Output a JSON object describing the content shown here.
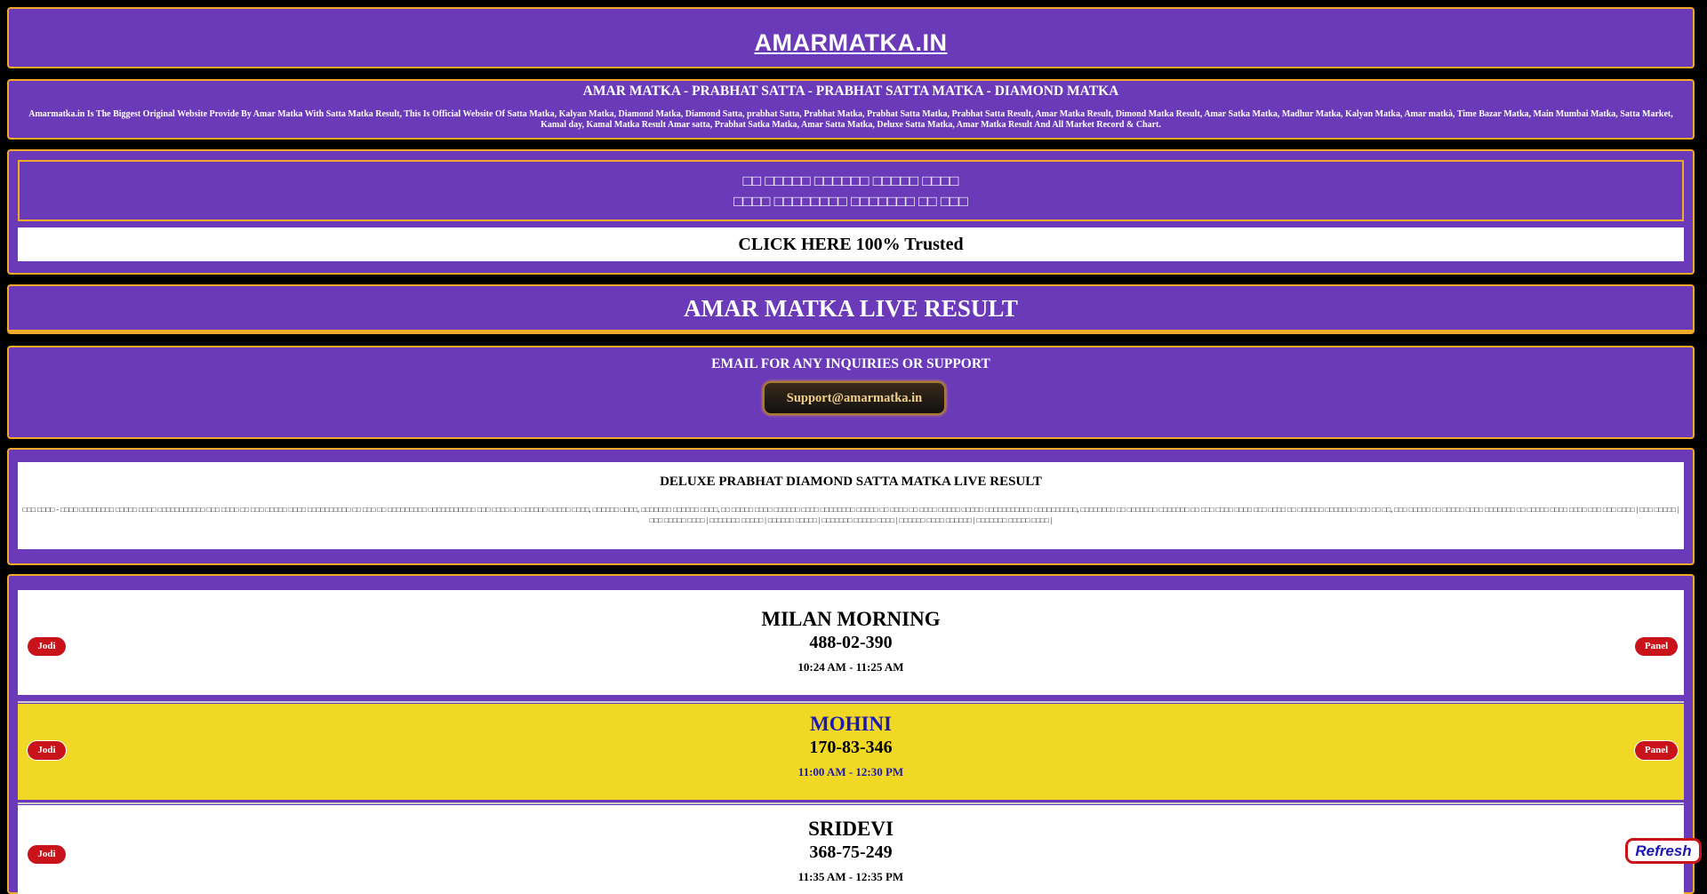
{
  "header": {
    "logo": "AMARMATKA.IN"
  },
  "intro": {
    "title": "AMAR MATKA - PRABHAT SATTA - PRABHAT SATTA MATKA - DIAMOND MATKA",
    "description": "Amarmatka.in Is The Biggest Original Website Provide By Amar Matka With Satta Matka Result, This Is Official Website Of Satta Matka, Kalyan Matka, Diamond Matka, Diamond Satta, prabhat Satta, Prabhat Matka, Prabhat Satta Matka, Prabhat Satta Result, Amar Matka Result, Dimond Matka Result, Amar Satka Matka, Madhur Matka, Kalyan Matka, Amar matkà, Time Bazar Matka, Main Mumbai Matka, Satta Market, Kamal day, Kamal Matka Result Amar satta, Prabhat Satka Matka, Amar Satta Matka, Deluxe Satta Matka, Amar Matka Result And All Market Record & Chart."
  },
  "banner": {
    "line1": "□□ □□□□□ □□□□□□ □□□□□ □□□□",
    "line2": "□□□□ □□□□□□□□ □□□□□□□ □□ □□□",
    "cta": "CLICK HERE 100% Trusted"
  },
  "live": {
    "title": "AMAR MATKA LIVE RESULT"
  },
  "support": {
    "title": "EMAIL FOR ANY INQUIRIES OR SUPPORT",
    "email": "Support@amarmatka.in"
  },
  "deluxe": {
    "title": "DELUXE PRABHAT DIAMOND SATTA MATKA LIVE RESULT",
    "description": "□□□ □□□□ - □□□□ □□□□□□□□ □□□□□ □□□□ □□□□□□□□□□□ □□□ □□□□ □□ □□□ □□□□□ □□□□ □□□□□□□□□□ □□ □□□ □□ □□□□□□□□□ □□□□□□□□□□□ □□□ □□□□ □□ □□□□□□ □□□□□ □□□□, □□□□□□ □□□□, □□□□□□□ □□□□□□ □□□□, □□ □□□□□ □□□□ □□□□□□ □□□□ □□□□□□□□ □□□□□ □□ □□□□ □□ □□□□ □□□□□ □□□□□ □□□□□□□□□□□ □□□□□□□□□□, □□□□□□□□ □□ □□□□□□□ □□□□□□□ □□ □□□ □□□□ □□□□ □□□ □□□□ □□ □□□□□□ □□□□□□□ □□□ □□ □□, □□□ □□□□□ □□ □□□□□ □□□□ □□□□□□□ □□ □□□□□ □□□□ □□□□ □□□ □□□ □□□□ | □□□ □□□□□ | □□□ □□□□□ □□□□ | □□□□□□□ □□□□□ | □□□□□□ □□□□□ | □□□□□□□ □□□□□ □□□□ | □□□□□□ □□□□ □□□□□□ | □□□□□□□ □□□□□ □□□□ |"
  },
  "results": {
    "jodi_label": "Jodi",
    "panel_label": "Panel",
    "markets": [
      {
        "name": "MILAN MORNING",
        "result": "488-02-390",
        "time": "10:24 AM - 11:25 AM"
      },
      {
        "name": "MOHINI",
        "result": "170-83-346",
        "time": "11:00 AM - 12:30 PM"
      },
      {
        "name": "SRIDEVI",
        "result": "368-75-249",
        "time": "11:35 AM - 12:35 PM"
      }
    ]
  },
  "refresh_label": "Refresh",
  "colors": {
    "panel_bg": "#6b3ab9",
    "border_accent": "#f0a928",
    "highlight_row": "#f0d824",
    "pill_red": "#c8131b",
    "highlight_text": "#1c19b0"
  }
}
